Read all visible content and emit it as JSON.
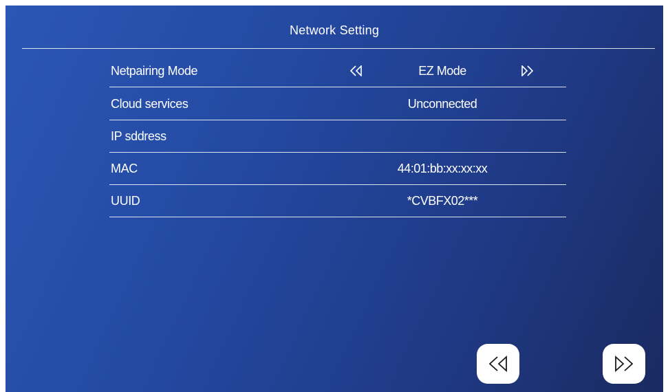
{
  "header": {
    "title": "Network Setting"
  },
  "rows": {
    "netpairing_mode": {
      "label": "Netpairing Mode",
      "value": "EZ Mode",
      "prev_icon": "double-chevron-left-icon",
      "next_icon": "double-chevron-right-icon"
    },
    "cloud_services": {
      "label": "Cloud services",
      "value": "Unconnected"
    },
    "ip_address": {
      "label": "IP sddress",
      "value": ""
    },
    "mac": {
      "label": "MAC",
      "value": "44:01:bb:xx:xx:xx"
    },
    "uuid": {
      "label": "UUID",
      "value": "*CVBFX02***"
    }
  },
  "footer": {
    "prev_icon": "double-chevron-left-icon",
    "next_icon": "double-chevron-right-icon"
  },
  "colors": {
    "background_start": "#2b57b4",
    "background_end": "#1a2a60",
    "text": "#ffffff",
    "divider": "#ffffff",
    "button_bg": "#ffffff",
    "button_icon": "#1a1a1a"
  }
}
